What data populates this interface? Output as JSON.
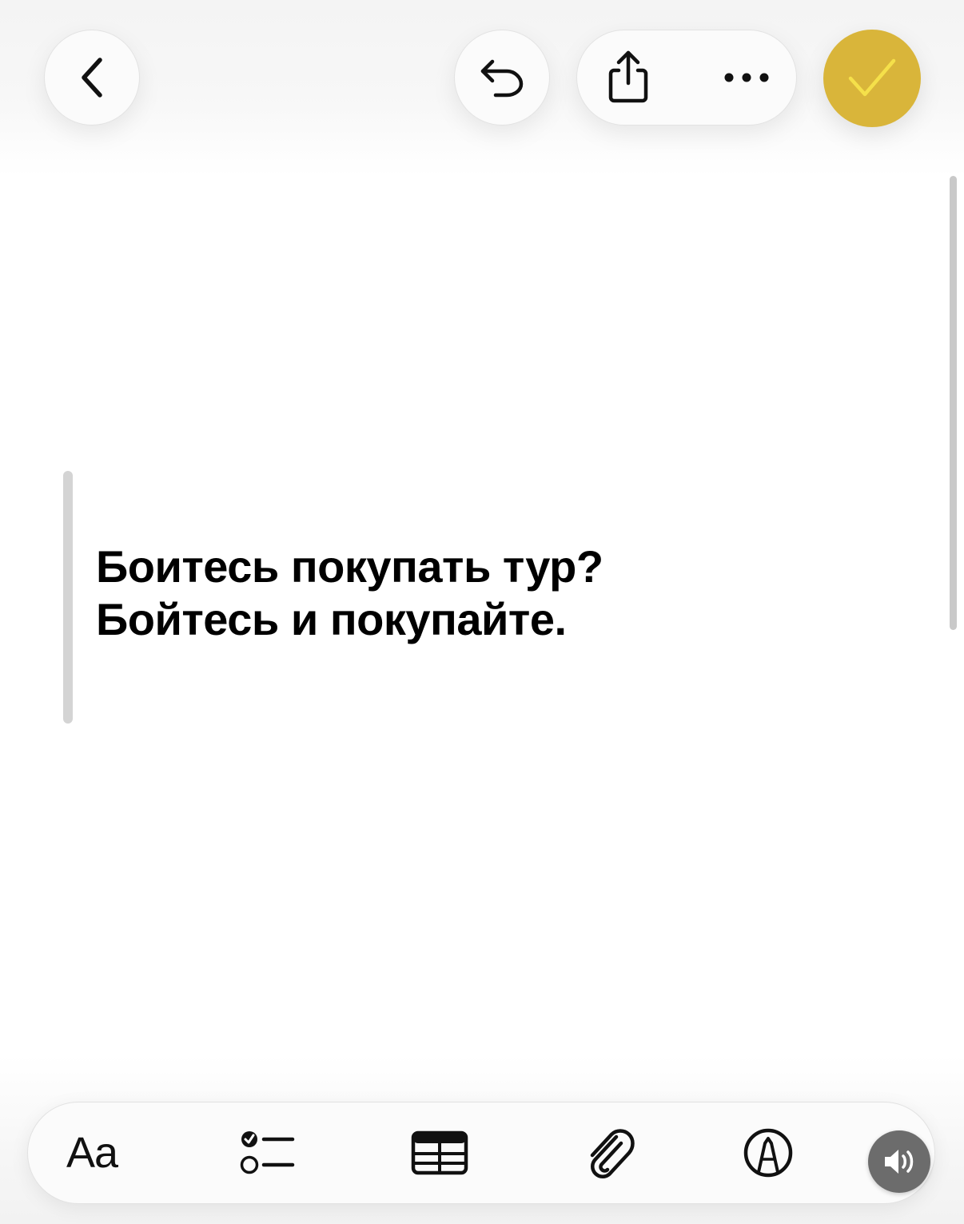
{
  "note": {
    "lines": [
      "Боитесь покупать тур?",
      "Бойтесь и покупайте."
    ]
  },
  "toolbar": {
    "format_label": "Aa"
  },
  "icons": {
    "back": "chevron-left-icon",
    "undo": "undo-icon",
    "share": "share-icon",
    "more": "ellipsis-icon",
    "done": "checkmark-icon",
    "checklist": "checklist-icon",
    "table": "table-icon",
    "attach": "paperclip-icon",
    "markup": "pen-markup-icon",
    "speaker": "speaker-icon"
  },
  "colors": {
    "accent": "#d9b53a",
    "check_stroke": "#f5e04a",
    "text": "#000000"
  }
}
